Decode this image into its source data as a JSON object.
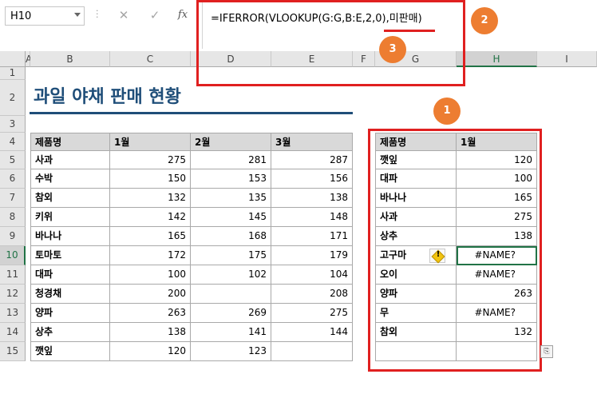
{
  "namebox": {
    "value": "H10"
  },
  "formula": {
    "prefix": "=IFERROR(VLOOKUP(G:G,B:E,2,0),",
    "underlined": "미판매",
    "suffix": ")"
  },
  "formula_buttons": {
    "cancel": "✕",
    "enter": "✓",
    "fx": "fx"
  },
  "columns": [
    "A",
    "B",
    "C",
    "D",
    "E",
    "F",
    "G",
    "H",
    "I"
  ],
  "rows": [
    "1",
    "2",
    "3",
    "4",
    "5",
    "6",
    "7",
    "8",
    "9",
    "10",
    "11",
    "12",
    "13",
    "14",
    "15"
  ],
  "selected": {
    "column": "H",
    "row": "10"
  },
  "title": "과일 야채 판매 현황",
  "left_table": {
    "headers": [
      "제품명",
      "1월",
      "2월",
      "3월"
    ],
    "rows": [
      [
        "사과",
        "275",
        "281",
        "287"
      ],
      [
        "수박",
        "150",
        "153",
        "156"
      ],
      [
        "참외",
        "132",
        "135",
        "138"
      ],
      [
        "키위",
        "142",
        "145",
        "148"
      ],
      [
        "바나나",
        "165",
        "168",
        "171"
      ],
      [
        "토마토",
        "172",
        "175",
        "179"
      ],
      [
        "대파",
        "100",
        "102",
        "104"
      ],
      [
        "청경채",
        "200",
        "",
        "208"
      ],
      [
        "양파",
        "263",
        "269",
        "275"
      ],
      [
        "상추",
        "138",
        "141",
        "144"
      ],
      [
        "깻잎",
        "120",
        "123",
        ""
      ]
    ]
  },
  "right_table": {
    "headers": [
      "제품명",
      "1월"
    ],
    "rows": [
      [
        "깻잎",
        "120"
      ],
      [
        "대파",
        "100"
      ],
      [
        "바나나",
        "165"
      ],
      [
        "사과",
        "275"
      ],
      [
        "상추",
        "138"
      ],
      [
        "고구마",
        "#NAME?"
      ],
      [
        "오이",
        "#NAME?"
      ],
      [
        "양파",
        "263"
      ],
      [
        "무",
        "#NAME?"
      ],
      [
        "참외",
        "132"
      ],
      [
        "",
        ""
      ]
    ]
  },
  "callouts": [
    "1",
    "2",
    "3"
  ],
  "colors": {
    "title": "#1f4e79",
    "highlight_box": "#e02020",
    "callout": "#ed7d31",
    "selection": "#217346"
  },
  "icons": {
    "warning": "exclamation-diamond-icon",
    "paste_options": "paste-options-icon"
  }
}
